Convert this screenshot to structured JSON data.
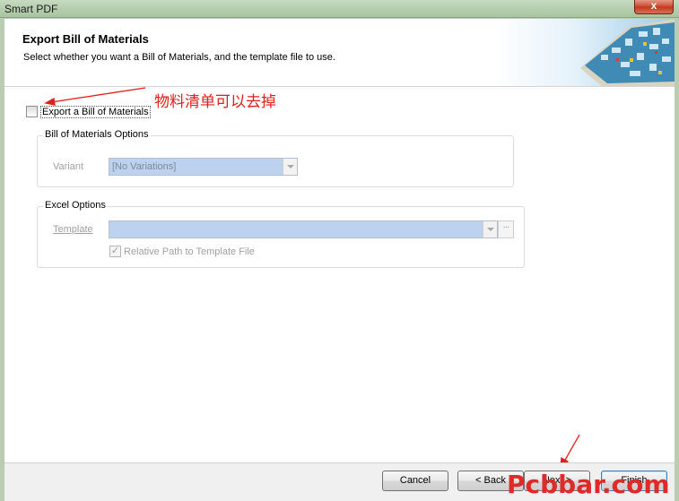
{
  "window": {
    "title": "Smart PDF",
    "close_symbol": "x"
  },
  "header": {
    "title": "Export Bill of Materials",
    "subtitle": "Select whether you want a Bill of Materials, and the template file to use."
  },
  "annotation": {
    "text": "物料清单可以去掉"
  },
  "export_bom": {
    "label": "Export a Bill of Materials",
    "checked": false
  },
  "bom_options": {
    "legend": "Bill of Materials Options",
    "variant_label": "Variant",
    "variant_value": "[No Variations]"
  },
  "excel_options": {
    "legend": "Excel Options",
    "template_label": "Template",
    "template_value": "",
    "browse_label": "···",
    "relative_path_label": "Relative Path to Template File",
    "relative_path_checked": true
  },
  "footer": {
    "cancel": "Cancel",
    "back": "< Back",
    "next": "Next >",
    "finish": "Finish"
  },
  "watermark": "Pcbbar.com",
  "colors": {
    "annotation": "#e0201c",
    "accent": "#3c7fb1",
    "combo_fill": "#bcd2ee"
  }
}
